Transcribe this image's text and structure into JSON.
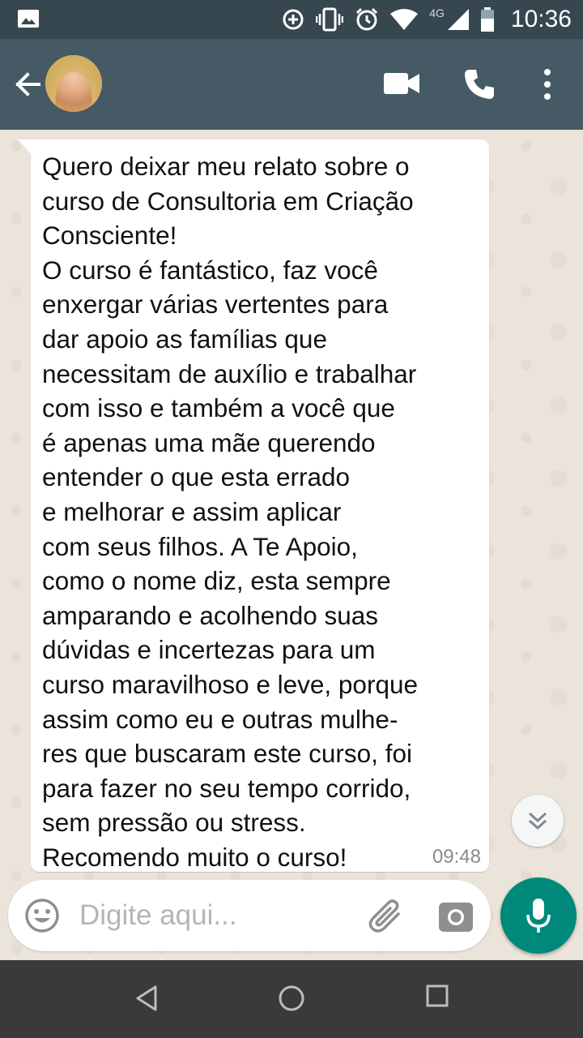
{
  "status_bar": {
    "network_label": "4G",
    "time": "10:36",
    "icons": [
      "image-icon",
      "data-saver-icon",
      "vibrate-icon",
      "alarm-icon",
      "wifi-icon",
      "signal-icon",
      "battery-icon"
    ]
  },
  "app_bar": {
    "icons": [
      "back-arrow-icon",
      "avatar",
      "video-call-icon",
      "phone-icon",
      "more-vert-icon"
    ],
    "color": "#455a64"
  },
  "message": {
    "text": "Quero deixar meu relato sobre o\ncurso de Consultoria em Criação\nConsciente!\nO curso é fantástico, faz você\nenxergar várias vertentes para\ndar apoio as famílias que\nnecessitam de auxílio e trabalhar\ncom isso e também a você que\né apenas uma mãe querendo\nentender o que esta errado\ne melhorar e  assim aplicar\ncom seus filhos. A Te Apoio,\ncomo o nome diz, esta sempre\namparando e acolhendo suas\ndúvidas e incertezas para um\ncurso maravilhoso e leve, porque\nassim como eu e outras mulhe-\nres que buscaram este curso, foi\npara fazer no seu tempo corrido,\nsem pressão ou stress.\nRecomendo muito o curso!",
    "time": "09:48"
  },
  "composer": {
    "placeholder": "Digite aqui...",
    "icons": [
      "emoji-icon",
      "attach-icon",
      "camera-icon",
      "mic-icon"
    ],
    "accent": "#00897b"
  },
  "nav_bar": {
    "icons": [
      "nav-back-icon",
      "nav-home-icon",
      "nav-recents-icon"
    ]
  }
}
